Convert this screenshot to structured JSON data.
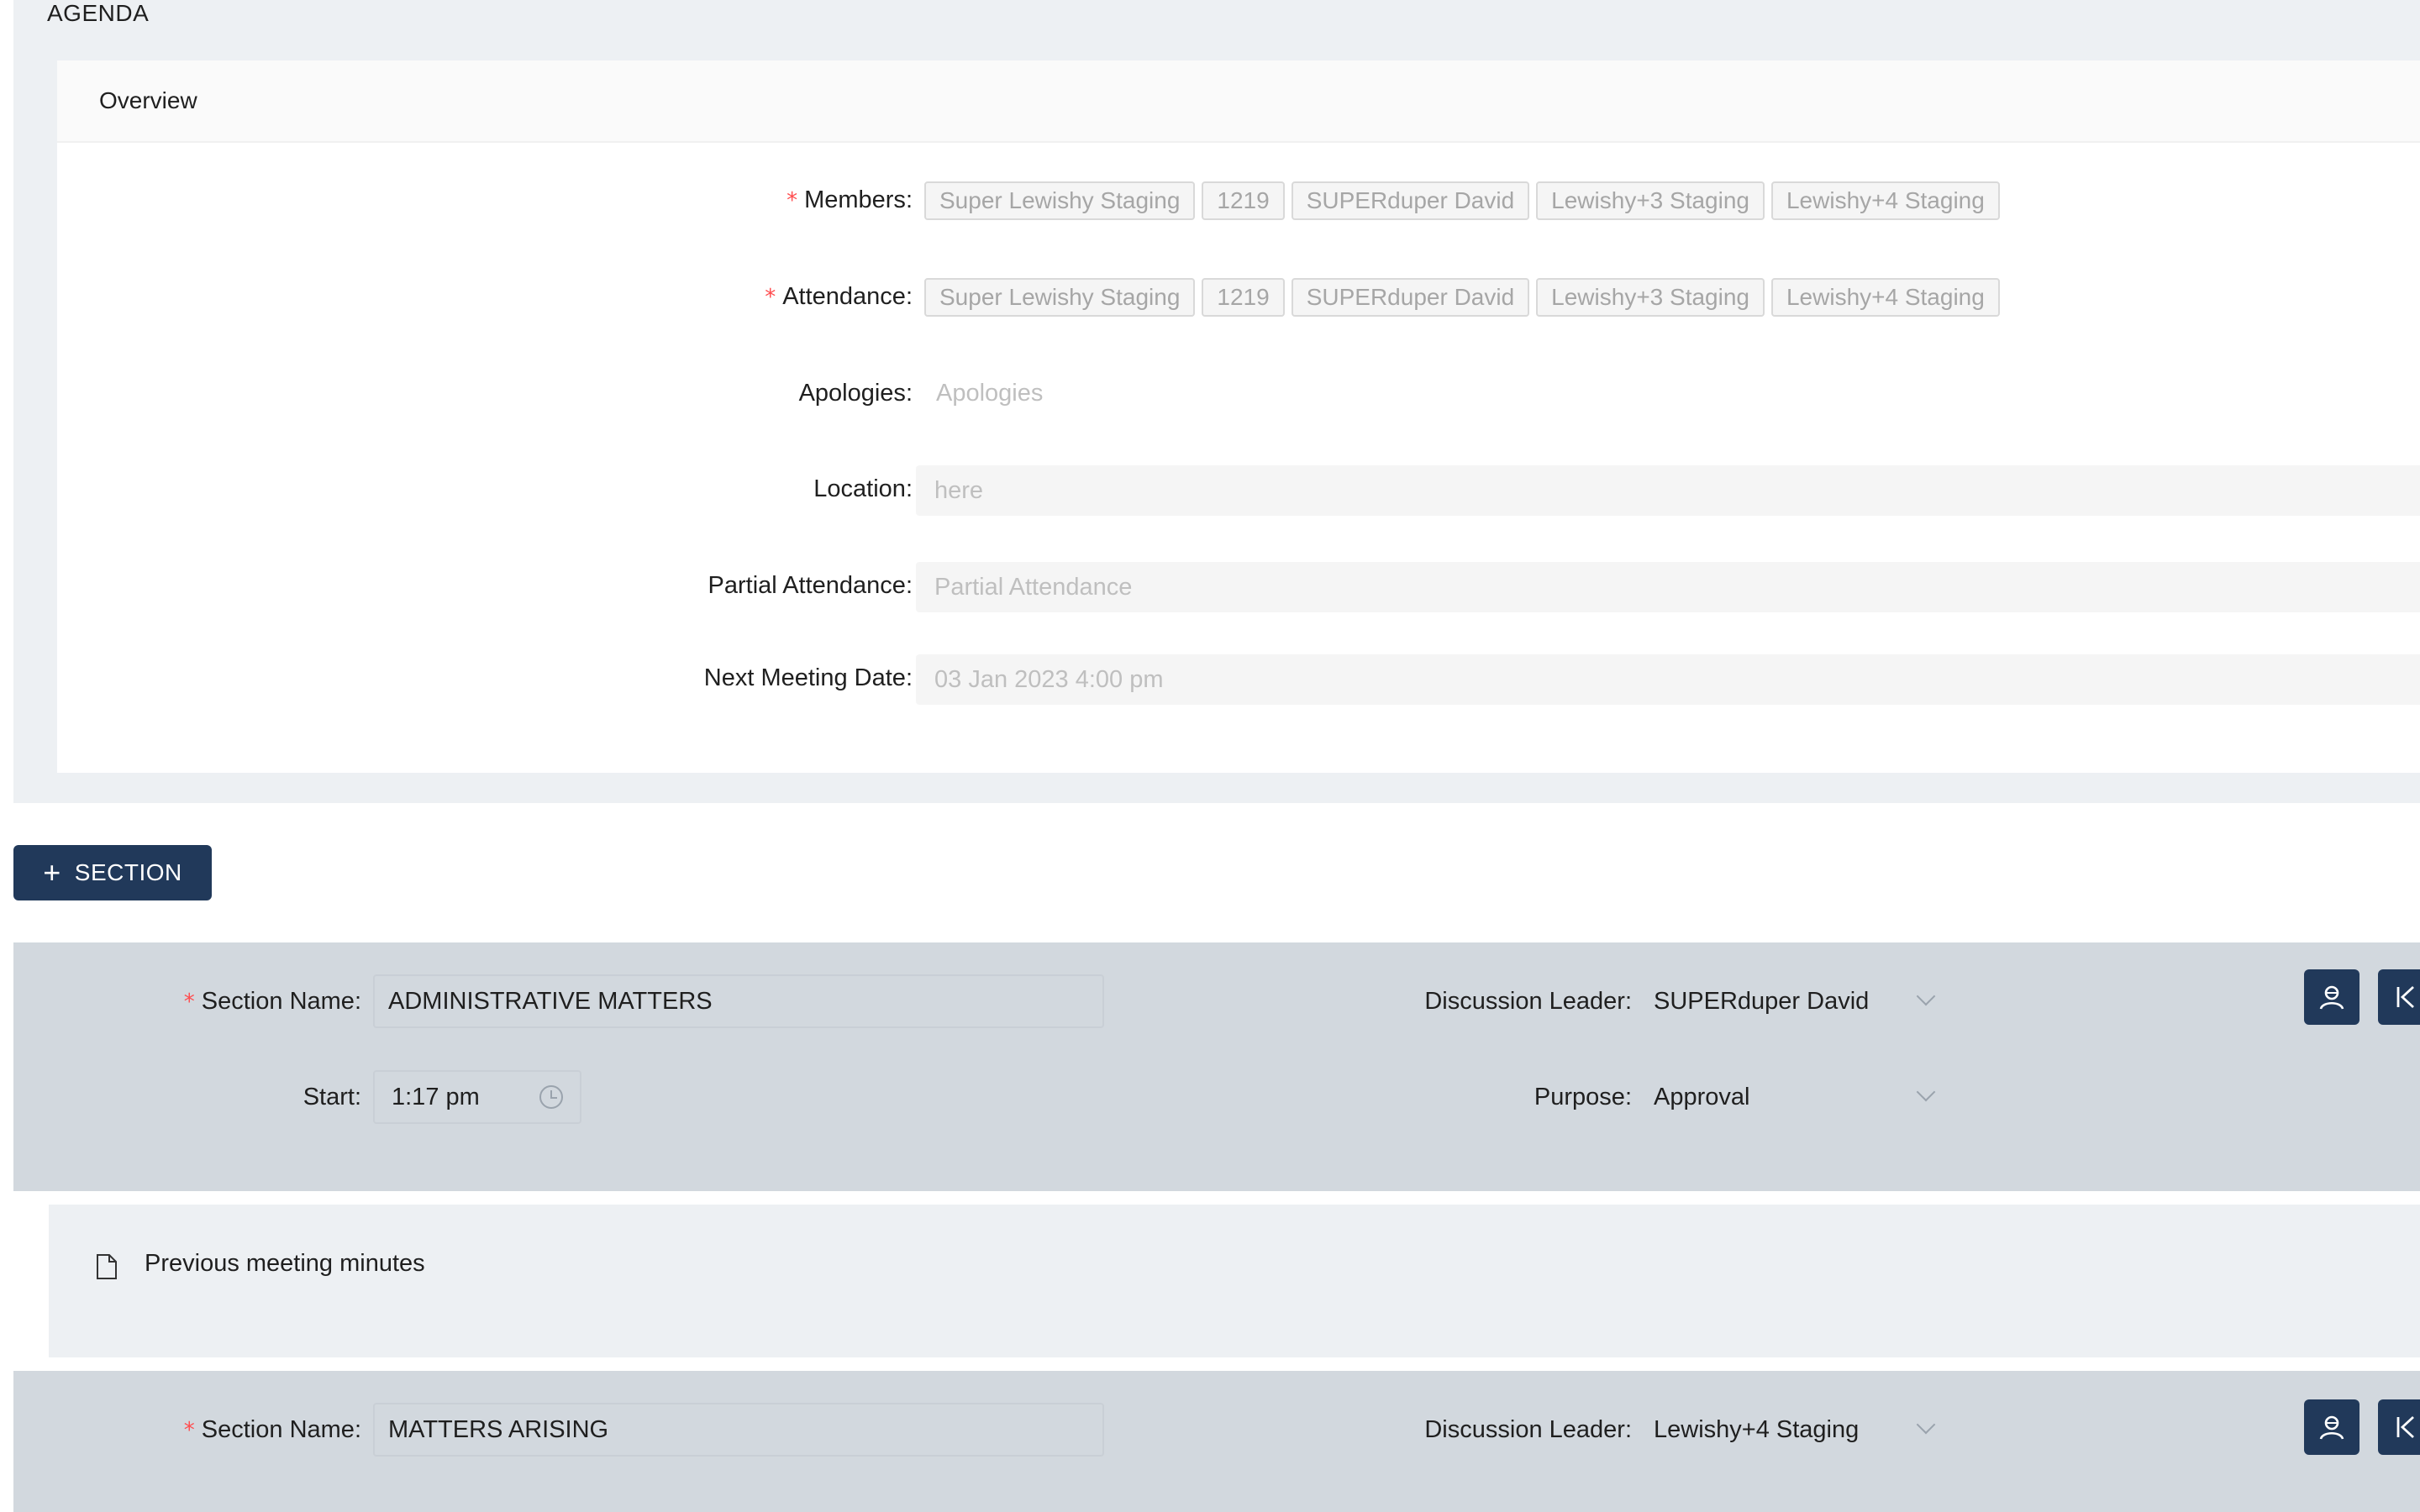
{
  "agenda": {
    "title": "AGENDA",
    "overview": {
      "title": "Overview",
      "members": {
        "label": "Members",
        "tags": [
          "Super Lewishy Staging",
          "1219",
          "SUPERduper David",
          "Lewishy+3 Staging",
          "Lewishy+4 Staging"
        ]
      },
      "attendance": {
        "label": "Attendance",
        "tags": [
          "Super Lewishy Staging",
          "1219",
          "SUPERduper David",
          "Lewishy+3 Staging",
          "Lewishy+4 Staging"
        ]
      },
      "apologies": {
        "label": "Apologies",
        "placeholder": "Apologies"
      },
      "location": {
        "label": "Location",
        "value": "here"
      },
      "partial_attendance": {
        "label": "Partial Attendance",
        "placeholder": "Partial Attendance"
      },
      "next_meeting_date": {
        "label": "Next Meeting Date",
        "value": "03 Jan 2023 4:00 pm"
      }
    }
  },
  "add_section": {
    "label": "SECTION",
    "icon": "plus-icon"
  },
  "sections": [
    {
      "name_label": "Section Name",
      "name_value": "ADMINISTRATIVE MATTERS",
      "leader_label": "Discussion Leader",
      "leader_value": "SUPERduper David",
      "start_label": "Start",
      "start_value": "1:17 pm",
      "purpose_label": "Purpose",
      "purpose_value": "Approval",
      "items": [
        {
          "icon": "file-icon",
          "text": "Previous meeting minutes"
        }
      ]
    },
    {
      "name_label": "Section Name",
      "name_value": "MATTERS ARISING",
      "leader_label": "Discussion Leader",
      "leader_value": "Lewishy+4 Staging"
    }
  ],
  "colors": {
    "primary": "#21395a",
    "section_bg": "#d2d8de",
    "panel_bg": "#edf0f3",
    "required": "#ff4d4f"
  },
  "separator": ":",
  "required_mark": "*"
}
